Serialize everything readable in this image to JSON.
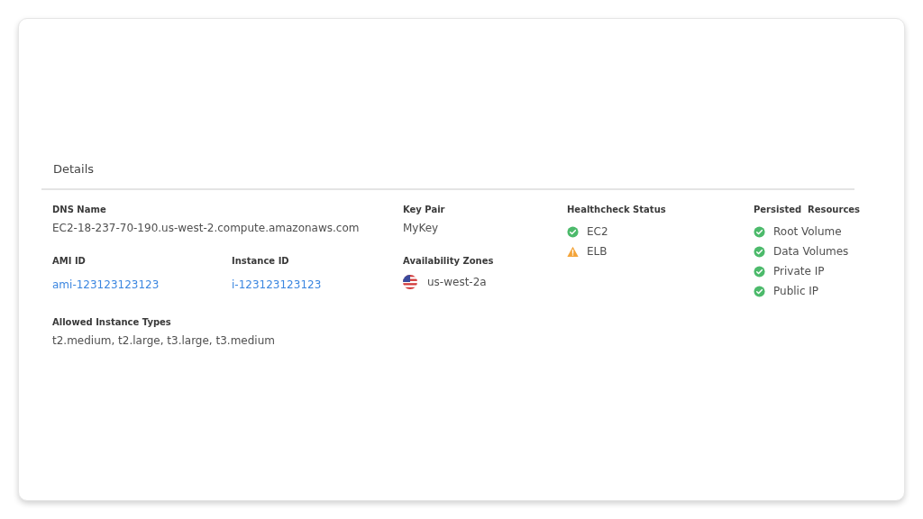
{
  "section": {
    "title": "Details"
  },
  "dns_name": {
    "label": "DNS Name",
    "value": "EC2-18-237-70-190.us-west-2.compute.amazonaws.com"
  },
  "ami_id": {
    "label": "AMI ID",
    "value": "ami-123123123123"
  },
  "instance_id": {
    "label": "Instance ID",
    "value": "i-123123123123"
  },
  "allowed_instance_types": {
    "label": "Allowed Instance Types",
    "value": "t2.medium, t2.large, t3.large, t3.medium"
  },
  "key_pair": {
    "label": "Key Pair",
    "value": "MyKey"
  },
  "availability_zones": {
    "label": "Availability Zones",
    "items": [
      "us-west-2a"
    ]
  },
  "healthcheck_status": {
    "label": "Healthcheck Status",
    "items": [
      {
        "name": "EC2",
        "healthy": true
      },
      {
        "name": "ELB",
        "healthy": false
      }
    ]
  },
  "persisted_resources": {
    "label": "Persisted  Resources",
    "items": [
      {
        "name": "Root Volume",
        "healthy": true
      },
      {
        "name": "Data Volumes",
        "healthy": true
      },
      {
        "name": "Private IP",
        "healthy": true
      },
      {
        "name": "Public IP",
        "healthy": true
      }
    ]
  }
}
